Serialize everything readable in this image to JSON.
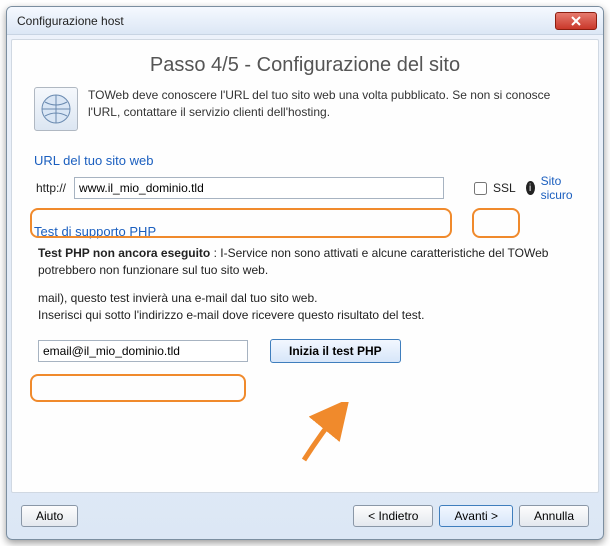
{
  "window": {
    "title": "Configurazione host"
  },
  "step": {
    "title": "Passo 4/5 - Configurazione del sito"
  },
  "intro": {
    "text": "TOWeb deve conoscere l'URL del tuo sito web una volta pubblicato. Se non si conosce l'URL, contattare il servizio clienti dell'hosting."
  },
  "url_section": {
    "heading": "URL del tuo sito web",
    "prefix": "http://",
    "value": "www.il_mio_dominio.tld",
    "ssl_label": "SSL",
    "secure_link": "Sito sicuro"
  },
  "php_section": {
    "heading": "Test di supporto PHP",
    "line1_bold": "Test PHP non ancora eseguito",
    "line1_rest": " : I-Service non sono attivati e alcune caratteristiche del TOWeb potrebbero non funzionare sul tuo sito web.",
    "line2_a": "mail), questo test invierà una e-mail dal tuo sito web.",
    "line2_b": "Inserisci qui sotto l'indirizzo e-mail dove ricevere questo risultato del test.",
    "email_value": "email@il_mio_dominio.tld",
    "start_btn": "Inizia il test PHP"
  },
  "footer": {
    "help": "Aiuto",
    "back": "< Indietro",
    "next": "Avanti >",
    "cancel": "Annulla"
  }
}
